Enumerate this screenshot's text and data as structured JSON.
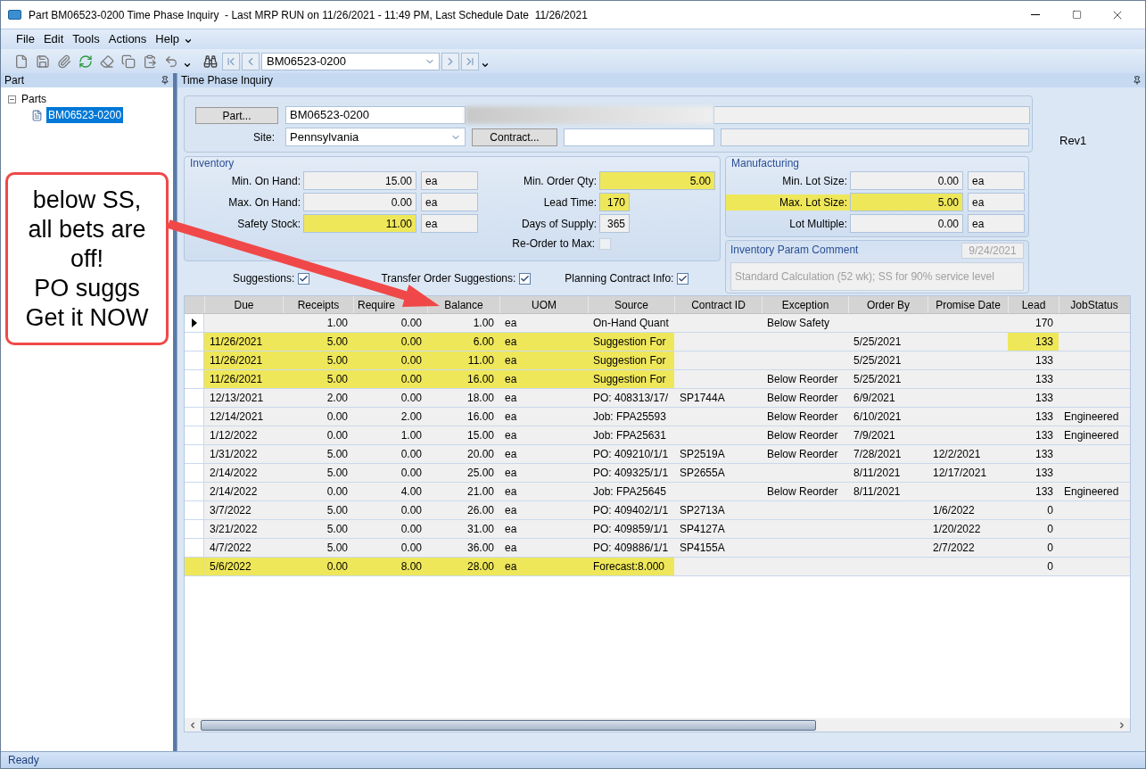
{
  "window": {
    "title": "Part BM06523-0200 Time Phase Inquiry  - Last MRP RUN on 11/26/2021 - 11:49 PM, Last Schedule Date  11/26/2021"
  },
  "menu": [
    "File",
    "Edit",
    "Tools",
    "Actions",
    "Help"
  ],
  "toolbar": {
    "part_combo": "BM06523-0200"
  },
  "left_panel": {
    "title": "Part",
    "tree": [
      {
        "label": "Parts",
        "expanded": true,
        "selected": false,
        "children": [
          {
            "label": "BM06523-0200",
            "selected": true
          }
        ]
      }
    ]
  },
  "main_panel": {
    "title": "Time Phase Inquiry"
  },
  "header": {
    "part_button": "Part...",
    "part": "BM06523-0200",
    "site_label": "Site:",
    "site": "Pennsylvania",
    "contract_button": "Contract...",
    "revision": "Rev1"
  },
  "inventory": {
    "title": "Inventory",
    "fields": [
      {
        "label": "Min. On Hand:",
        "value": "15.00",
        "uom": "ea",
        "highlighted": false
      },
      {
        "label": "Max. On Hand:",
        "value": "0.00",
        "uom": "ea",
        "highlighted": false
      },
      {
        "label": "Safety Stock:",
        "value": "11.00",
        "uom": "ea",
        "highlighted": true
      }
    ],
    "right_fields": [
      {
        "label": "Min. Order Qty:",
        "value": "5.00",
        "kind": "wide",
        "highlighted": true
      },
      {
        "label": "Lead Time:",
        "value": "170",
        "kind": "narrow",
        "highlighted": true
      },
      {
        "label": "Days of Supply:",
        "value": "365",
        "kind": "narrow",
        "highlighted": false
      }
    ],
    "reorder_to_max": {
      "label": "Re-Order to Max:",
      "checked": false
    }
  },
  "manufacturing": {
    "title": "Manufacturing",
    "fields": [
      {
        "label": "Min. Lot Size:",
        "value": "0.00",
        "uom": "ea",
        "highlighted": false
      },
      {
        "label": "Max. Lot Size:",
        "value": "5.00",
        "uom": "ea",
        "highlighted": true
      },
      {
        "label": "Lot Multiple:",
        "value": "0.00",
        "uom": "ea",
        "highlighted": false
      }
    ]
  },
  "comment": {
    "title": "Inventory Param Comment",
    "date": "9/24/2021",
    "text": "Standard Calculation (52 wk); SS for 90% service level"
  },
  "options": [
    {
      "label": "Suggestions:",
      "checked": true
    },
    {
      "label": "Transfer Order Suggestions:",
      "checked": true
    },
    {
      "label": "Planning Contract Info:",
      "checked": true
    }
  ],
  "grid": {
    "columns": [
      "Due",
      "Receipts",
      "Require",
      "Balance",
      "UOM",
      "Source",
      "Contract ID",
      "Exception",
      "Order By",
      "Promise Date",
      "Lead",
      "JobStatus"
    ],
    "rows": [
      {
        "current": true,
        "highlighted": false,
        "lead_highlighted": false,
        "cells": [
          null,
          "1.00",
          "0.00",
          "1.00",
          "ea",
          "On-Hand Quant",
          null,
          "Below Safety",
          null,
          null,
          "170",
          null
        ]
      },
      {
        "current": false,
        "highlighted": true,
        "lead_highlighted": true,
        "cells": [
          "11/26/2021",
          "5.00",
          "0.00",
          "6.00",
          "ea",
          "Suggestion For",
          null,
          null,
          "5/25/2021",
          null,
          "133",
          null
        ]
      },
      {
        "current": false,
        "highlighted": true,
        "lead_highlighted": false,
        "cells": [
          "11/26/2021",
          "5.00",
          "0.00",
          "11.00",
          "ea",
          "Suggestion For",
          null,
          null,
          "5/25/2021",
          null,
          "133",
          null
        ]
      },
      {
        "current": false,
        "highlighted": true,
        "lead_highlighted": false,
        "cells": [
          "11/26/2021",
          "5.00",
          "0.00",
          "16.00",
          "ea",
          "Suggestion For",
          null,
          "Below Reorder",
          "5/25/2021",
          null,
          "133",
          null
        ]
      },
      {
        "current": false,
        "highlighted": false,
        "lead_highlighted": false,
        "cells": [
          "12/13/2021",
          "2.00",
          "0.00",
          "18.00",
          "ea",
          "PO: 408313/17/",
          "SP1744A",
          "Below Reorder",
          "6/9/2021",
          null,
          "133",
          null
        ]
      },
      {
        "current": false,
        "highlighted": false,
        "lead_highlighted": false,
        "cells": [
          "12/14/2021",
          "0.00",
          "2.00",
          "16.00",
          "ea",
          "Job: FPA25593",
          null,
          "Below Reorder",
          "6/10/2021",
          null,
          "133",
          "Engineered"
        ]
      },
      {
        "current": false,
        "highlighted": false,
        "lead_highlighted": false,
        "cells": [
          "1/12/2022",
          "0.00",
          "1.00",
          "15.00",
          "ea",
          "Job: FPA25631",
          null,
          "Below Reorder",
          "7/9/2021",
          null,
          "133",
          "Engineered"
        ]
      },
      {
        "current": false,
        "highlighted": false,
        "lead_highlighted": false,
        "cells": [
          "1/31/2022",
          "5.00",
          "0.00",
          "20.00",
          "ea",
          "PO: 409210/1/1",
          "SP2519A",
          "Below Reorder",
          "7/28/2021",
          "12/2/2021",
          "133",
          null
        ]
      },
      {
        "current": false,
        "highlighted": false,
        "lead_highlighted": false,
        "cells": [
          "2/14/2022",
          "5.00",
          "0.00",
          "25.00",
          "ea",
          "PO: 409325/1/1",
          "SP2655A",
          null,
          "8/11/2021",
          "12/17/2021",
          "133",
          null
        ]
      },
      {
        "current": false,
        "highlighted": false,
        "lead_highlighted": false,
        "cells": [
          "2/14/2022",
          "0.00",
          "4.00",
          "21.00",
          "ea",
          "Job: FPA25645",
          null,
          "Below Reorder",
          "8/11/2021",
          null,
          "133",
          "Engineered"
        ]
      },
      {
        "current": false,
        "highlighted": false,
        "lead_highlighted": false,
        "cells": [
          "3/7/2022",
          "5.00",
          "0.00",
          "26.00",
          "ea",
          "PO: 409402/1/1",
          "SP2713A",
          null,
          null,
          "1/6/2022",
          "0",
          null
        ]
      },
      {
        "current": false,
        "highlighted": false,
        "lead_highlighted": false,
        "cells": [
          "3/21/2022",
          "5.00",
          "0.00",
          "31.00",
          "ea",
          "PO: 409859/1/1",
          "SP4127A",
          null,
          null,
          "1/20/2022",
          "0",
          null
        ]
      },
      {
        "current": false,
        "highlighted": false,
        "lead_highlighted": false,
        "cells": [
          "4/7/2022",
          "5.00",
          "0.00",
          "36.00",
          "ea",
          "PO: 409886/1/1",
          "SP4155A",
          null,
          null,
          "2/7/2022",
          "0",
          null
        ]
      },
      {
        "current": false,
        "highlighted": true,
        "lead_highlighted": false,
        "cells": [
          "5/6/2022",
          "0.00",
          "8.00",
          "28.00",
          "ea",
          "Forecast:8.000",
          null,
          null,
          null,
          null,
          "0",
          null
        ]
      }
    ]
  },
  "annotation": {
    "lines": [
      "below SS,",
      "all bets are",
      "off!",
      "PO suggs",
      "Get it NOW"
    ]
  },
  "status_bar": {
    "text": "Ready"
  }
}
